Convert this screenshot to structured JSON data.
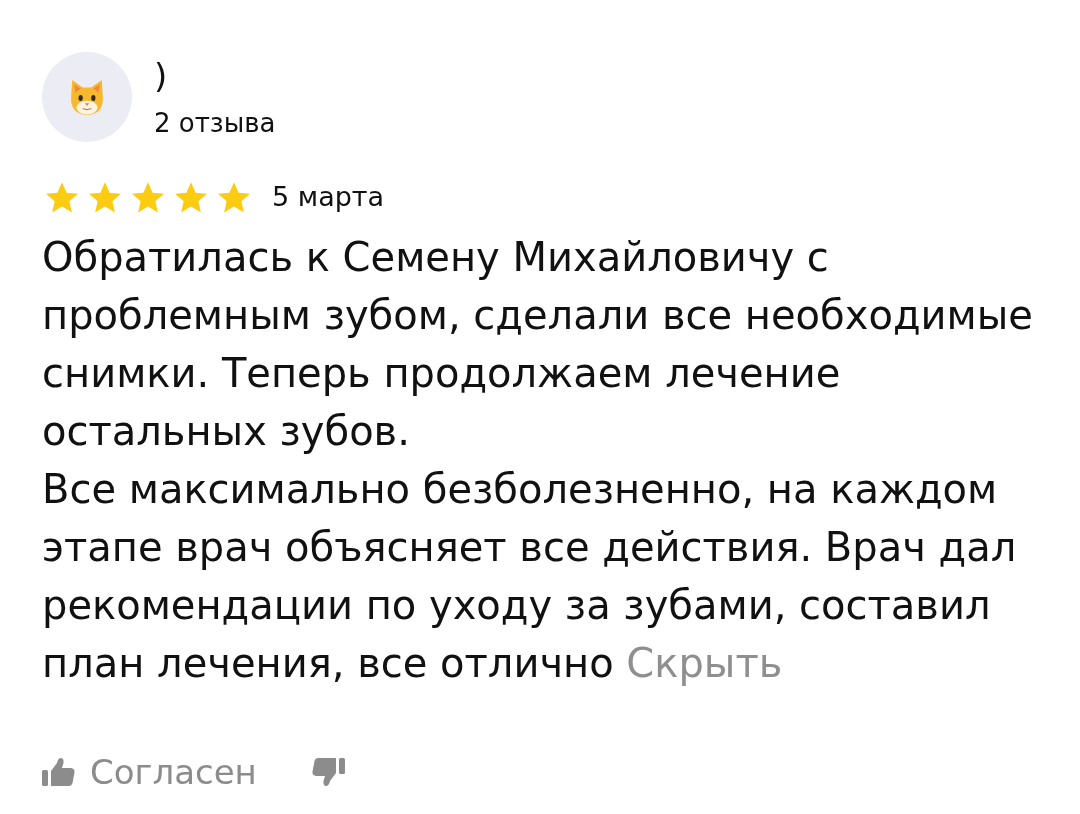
{
  "author": {
    "name": ")",
    "reviews_count": "2 отзыва"
  },
  "review": {
    "stars": 5,
    "date": "5 марта",
    "paragraphs": [
      "Обратилась к Семену Михайловичу с проблемным зубом, сделали все необходимые снимки. Теперь продолжаем лечение остальных зубов.",
      "Все максимально безболезненно, на каждом этапе врач объясняет все действия. Врач дал рекомендации по уходу за зубами, составил план лечения, все отлично"
    ],
    "collapse_link": "Скрыть"
  },
  "reactions": {
    "agree_label": "Согласен"
  }
}
